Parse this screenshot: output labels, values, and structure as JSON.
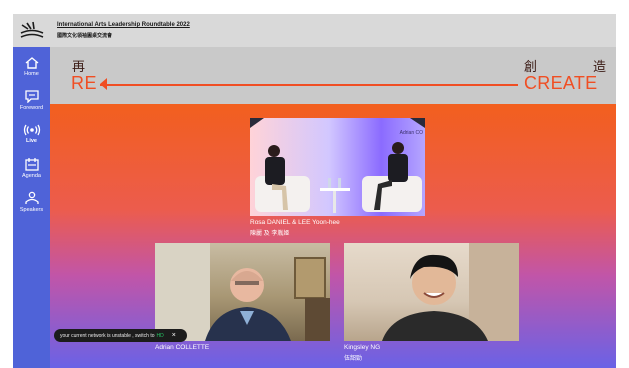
{
  "header": {
    "title": "International Arts Leadership Roundtable 2022",
    "subtitle": "國際文化領袖圓桌交流會"
  },
  "sidebar": {
    "items": [
      {
        "label": "Home",
        "icon": "home-icon"
      },
      {
        "label": "Foreword",
        "icon": "chat-icon"
      },
      {
        "label": "Live",
        "icon": "broadcast-icon"
      },
      {
        "label": "Agenda",
        "icon": "calendar-icon"
      },
      {
        "label": "Speakers",
        "icon": "person-icon"
      }
    ]
  },
  "banner": {
    "left_chinese": "再",
    "left_text": "RE",
    "right_chinese": [
      "創",
      "造"
    ],
    "right_text": "CREATE"
  },
  "stage": {
    "main_video": {
      "watermark": "Adrian CO",
      "name": "Rosa DANIEL & LEE Yoon-hee",
      "name_cn": "陳麗 及 李胤姬"
    },
    "video_left": {
      "name": "Adrian COLLETTE"
    },
    "video_right": {
      "name": "Kingsley NG",
      "name_cn": "伍韶勁"
    }
  },
  "toast": {
    "message": "your current network is unstable , switch to",
    "hd": "HD",
    "close": "×"
  },
  "colors": {
    "accent": "#f04e23",
    "sidebar": "#4f63d8",
    "hd_green": "#25c865"
  }
}
